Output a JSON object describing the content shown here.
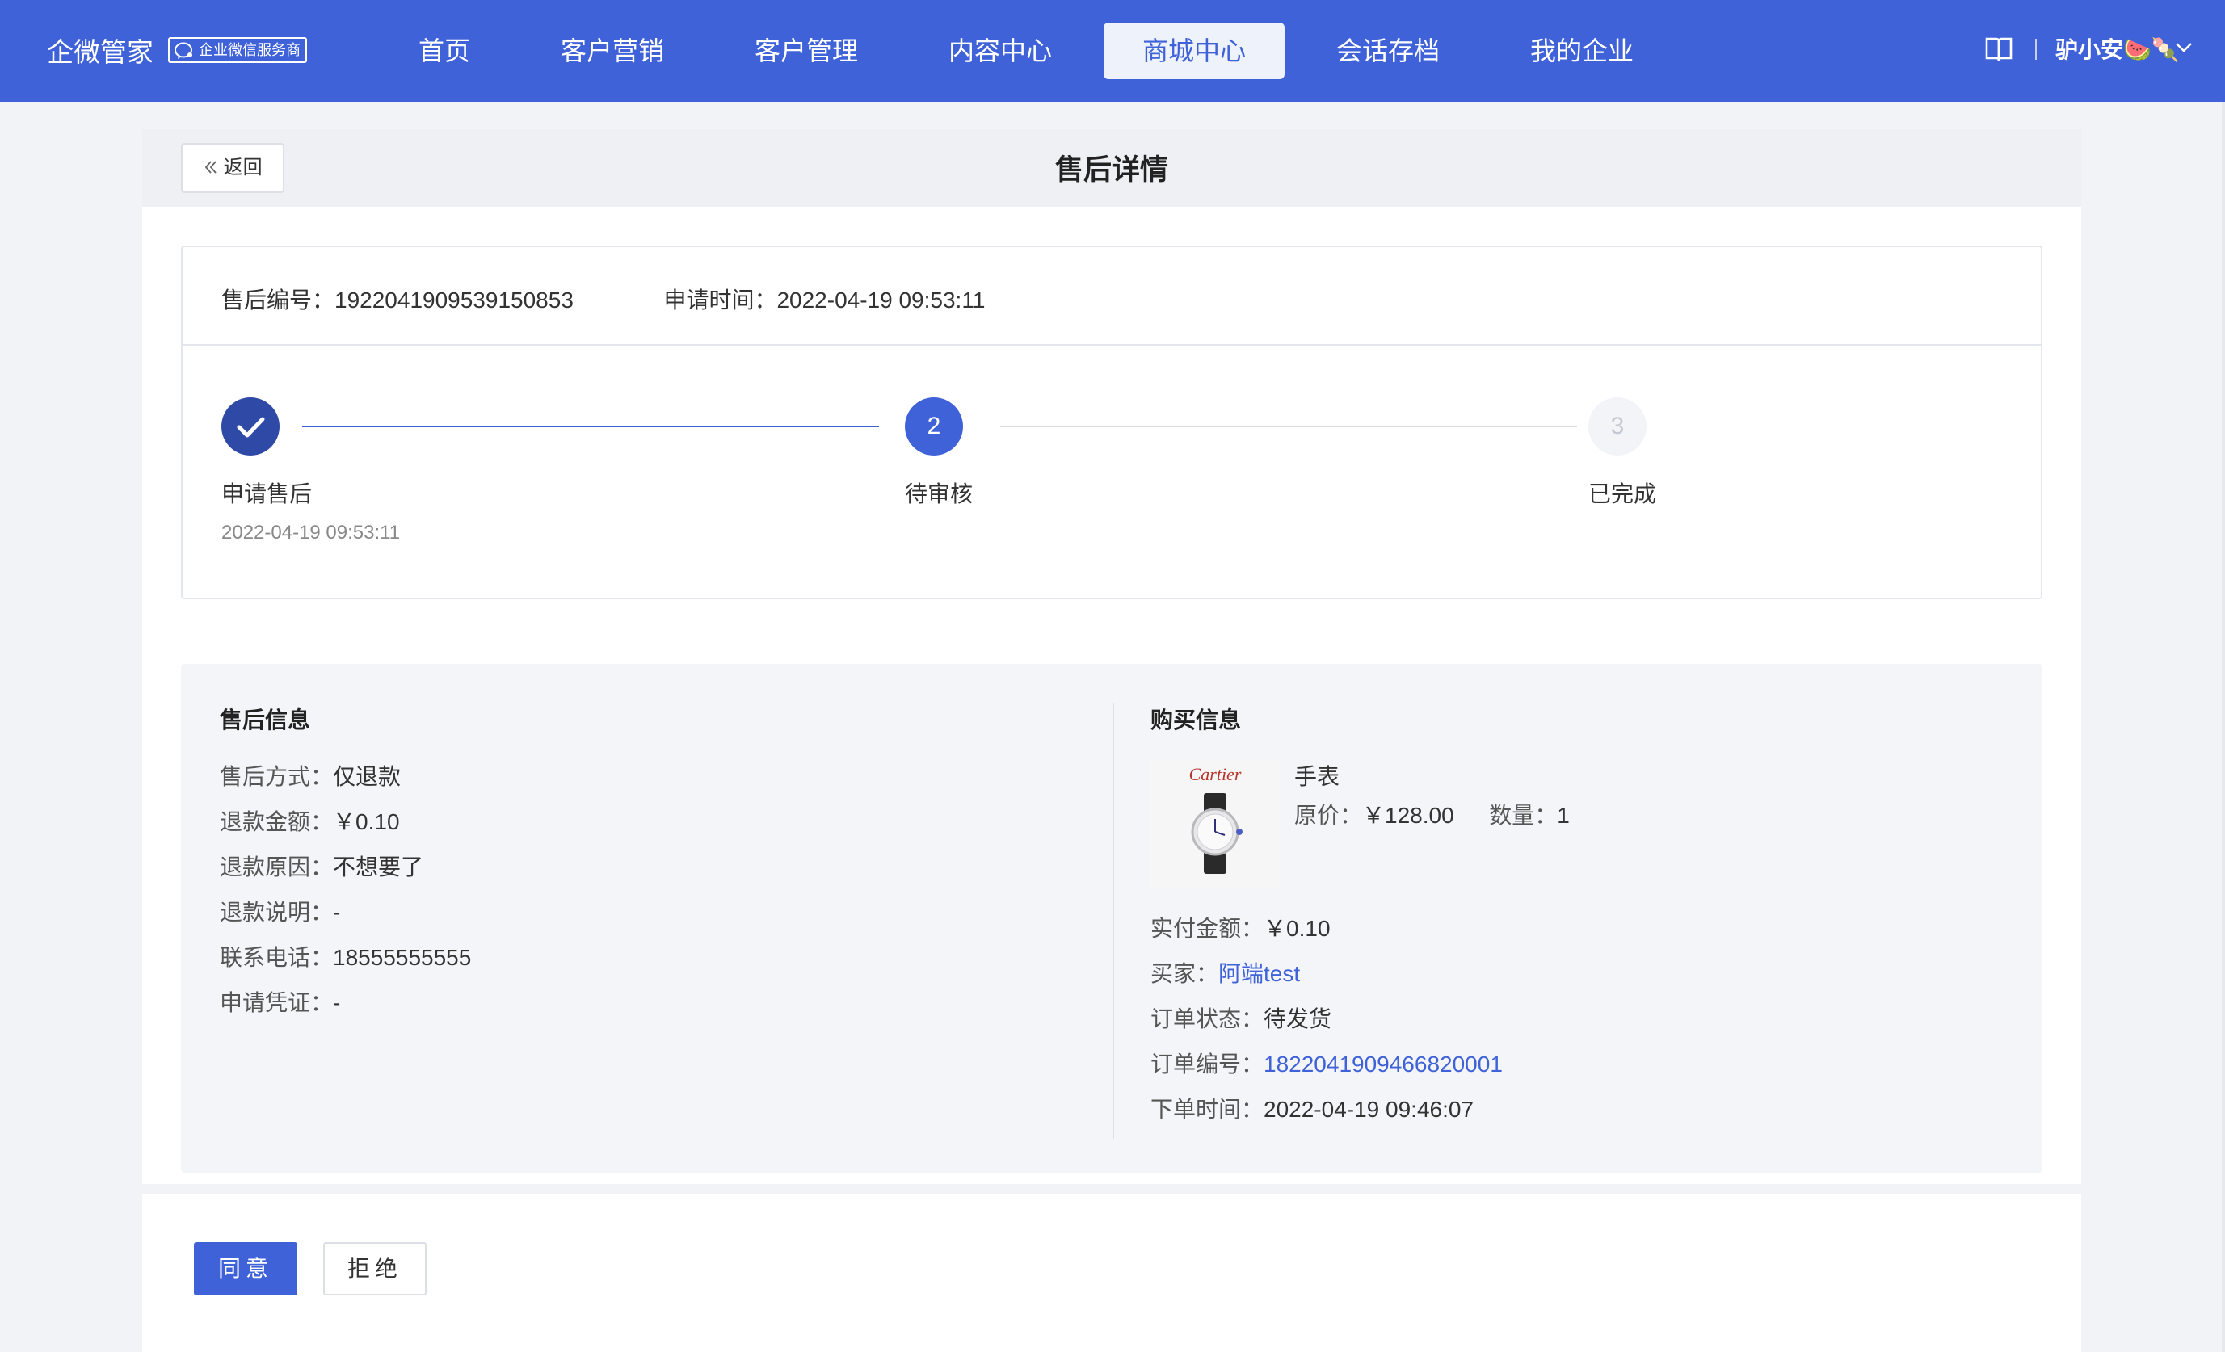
{
  "header": {
    "brand": "企微管家",
    "badge": "企业微信服务商",
    "nav": [
      "首页",
      "客户营销",
      "客户管理",
      "内容中心",
      "商城中心",
      "会话存档",
      "我的企业"
    ],
    "active_nav": "商城中心",
    "user": "驴小安🍉🍡",
    "accent_color": "#3f62d8"
  },
  "page": {
    "back_label": "返回",
    "title": "售后详情"
  },
  "order": {
    "aftersale_no_label": "售后编号：",
    "aftersale_no": "1922041909539150853",
    "apply_time_label": "申请时间：",
    "apply_time": "2022-04-19 09:53:11"
  },
  "steps": [
    {
      "num": "✓",
      "label": "申请售后",
      "time": "2022-04-19 09:53:11",
      "state": "done"
    },
    {
      "num": "2",
      "label": "待审核",
      "time": "",
      "state": "current"
    },
    {
      "num": "3",
      "label": "已完成",
      "time": "",
      "state": "pending"
    }
  ],
  "aftersale_info": {
    "title": "售后信息",
    "items": [
      {
        "label": "售后方式：",
        "value": "仅退款"
      },
      {
        "label": "退款金额：",
        "value": "￥0.10"
      },
      {
        "label": "退款原因：",
        "value": "不想要了"
      },
      {
        "label": "退款说明：",
        "value": "-"
      },
      {
        "label": "联系电话：",
        "value": "18555555555"
      },
      {
        "label": "申请凭证：",
        "value": "-"
      }
    ]
  },
  "purchase_info": {
    "title": "购买信息",
    "product_name": "手表",
    "thumb_brand": "Cartier",
    "original_price_label": "原价：",
    "original_price": "￥128.00",
    "quantity_label": "数量：",
    "quantity": "1",
    "items": [
      {
        "label": "实付金额：",
        "value": "￥0.10",
        "link": false
      },
      {
        "label": "买家：",
        "value": "阿端test",
        "link": true
      },
      {
        "label": "订单状态：",
        "value": "待发货",
        "link": false
      },
      {
        "label": "订单编号：",
        "value": "1822041909466820001",
        "link": true
      },
      {
        "label": "下单时间：",
        "value": "2022-04-19 09:46:07",
        "link": false
      }
    ]
  },
  "actions": {
    "agree": "同意",
    "reject": "拒绝"
  }
}
